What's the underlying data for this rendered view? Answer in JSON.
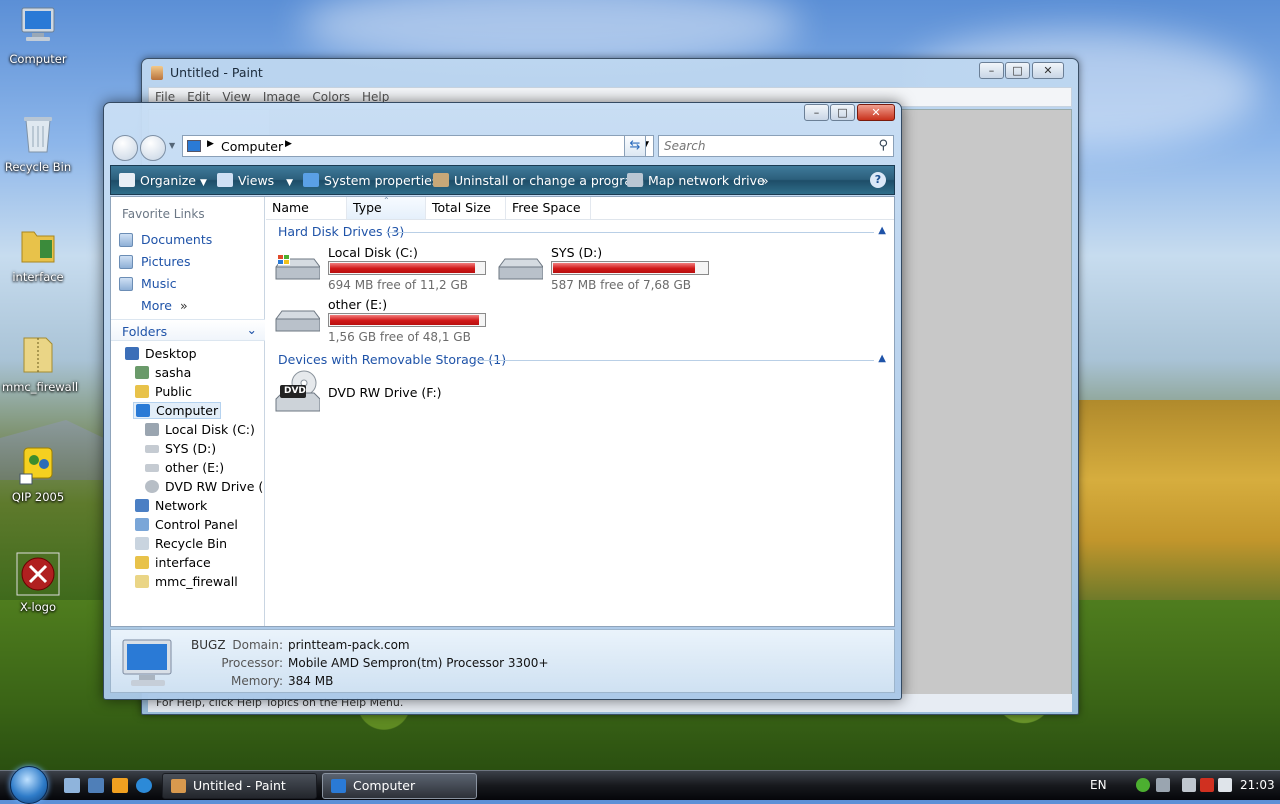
{
  "desktop": {
    "icons": [
      {
        "label": "Computer"
      },
      {
        "label": "Recycle Bin"
      },
      {
        "label": "interface"
      },
      {
        "label": "mmc_firewall"
      },
      {
        "label": "QIP 2005"
      },
      {
        "label": "X-logo"
      }
    ]
  },
  "paint": {
    "title": "Untitled - Paint",
    "menu": [
      "File",
      "Edit",
      "View",
      "Image",
      "Colors",
      "Help"
    ],
    "status_text": "For Help, click Help Topics on the Help Menu."
  },
  "explorer": {
    "address": "Computer",
    "search_placeholder": "Search",
    "toolbar": {
      "organize": "Organize",
      "views": "Views",
      "system_properties": "System properties",
      "uninstall": "Uninstall or change a program",
      "map_drive": "Map network drive",
      "more": "»"
    },
    "favorite_links": {
      "header": "Favorite Links",
      "items": [
        "Documents",
        "Pictures",
        "Music"
      ],
      "more": "More"
    },
    "folders": {
      "header": "Folders",
      "tree": [
        "Desktop",
        "sasha",
        "Public",
        "Computer",
        "Local Disk (C:)",
        "SYS (D:)",
        "other (E:)",
        "DVD RW Drive (F:",
        "Network",
        "Control Panel",
        "Recycle Bin",
        "interface",
        "mmc_firewall"
      ]
    },
    "columns": [
      "Name",
      "Type",
      "Total Size",
      "Free Space"
    ],
    "groups": {
      "hard_disk": "Hard Disk Drives (3)",
      "removable": "Devices with Removable Storage (1)"
    },
    "drives": [
      {
        "name": "Local Disk (C:)",
        "free_text": "694 MB free of 11,2 GB",
        "used_fraction": 0.94
      },
      {
        "name": "SYS (D:)",
        "free_text": "587 MB free of 7,68 GB",
        "used_fraction": 0.92
      },
      {
        "name": "other (E:)",
        "free_text": "1,56 GB free of 48,1 GB",
        "used_fraction": 0.97
      }
    ],
    "dvd": {
      "name": "DVD RW Drive (F:)",
      "badge": "DVD"
    },
    "details": {
      "computer_name": "BUGZ",
      "domain_label": "Domain:",
      "domain": "printteam-pack.com",
      "processor_label": "Processor:",
      "processor": "Mobile AMD Sempron(tm) Processor 3300+",
      "memory_label": "Memory:",
      "memory": "384 MB"
    }
  },
  "taskbar": {
    "tasks": [
      "Untitled - Paint",
      "Computer"
    ],
    "language": "EN",
    "clock": "21:03"
  },
  "colors": {
    "accent": "#1f53a8",
    "bar_fill": "#d01818",
    "toolbar": "#2c5f7c"
  }
}
